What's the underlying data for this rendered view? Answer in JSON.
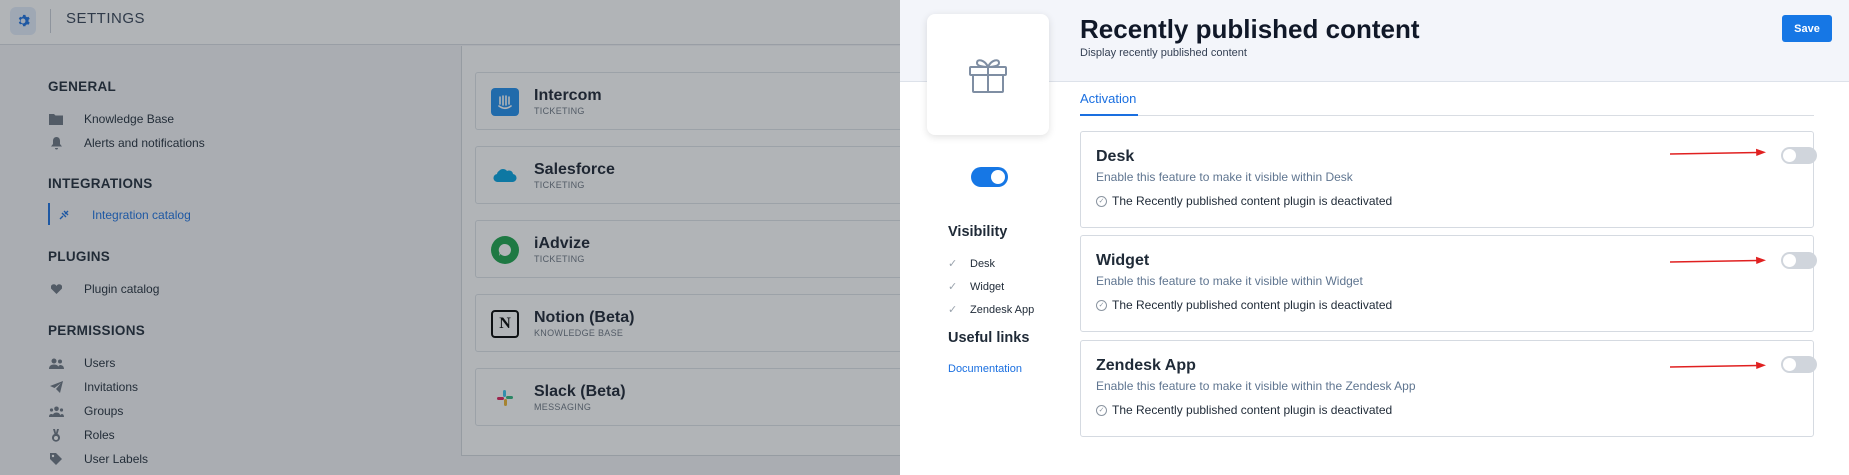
{
  "topbar": {
    "title": "SETTINGS",
    "icon": "gear-icon"
  },
  "sidebar": {
    "sections": [
      {
        "title": "GENERAL",
        "items": [
          {
            "label": "Knowledge Base",
            "icon": "folder-icon"
          },
          {
            "label": "Alerts and notifications",
            "icon": "bell-icon"
          }
        ]
      },
      {
        "title": "INTEGRATIONS",
        "items": [
          {
            "label": "Integration catalog",
            "icon": "plug-icon",
            "active": true
          }
        ]
      },
      {
        "title": "PLUGINS",
        "items": [
          {
            "label": "Plugin catalog",
            "icon": "heart-icon"
          }
        ]
      },
      {
        "title": "PERMISSIONS",
        "items": [
          {
            "label": "Users",
            "icon": "users-icon"
          },
          {
            "label": "Invitations",
            "icon": "paper-plane-icon"
          },
          {
            "label": "Groups",
            "icon": "group-icon"
          },
          {
            "label": "Roles",
            "icon": "medal-icon"
          },
          {
            "label": "User Labels",
            "icon": "tag-icon"
          }
        ]
      }
    ]
  },
  "catalog": {
    "items": [
      {
        "name": "Intercom",
        "category": "TICKETING",
        "icon": "intercom-logo",
        "color": "#1f8ded"
      },
      {
        "name": "Salesforce",
        "category": "TICKETING",
        "icon": "salesforce-logo",
        "color": "#00a1e0"
      },
      {
        "name": "iAdvize",
        "category": "TICKETING",
        "icon": "iadvize-logo",
        "color": "#19a34a"
      },
      {
        "name": "Notion (Beta)",
        "category": "KNOWLEDGE BASE",
        "icon": "notion-logo",
        "color": "#000000"
      },
      {
        "name": "Slack (Beta)",
        "category": "MESSAGING",
        "icon": "slack-logo",
        "color": "#e01e5a"
      }
    ]
  },
  "panel": {
    "title": "Recently published content",
    "subtitle": "Display recently published content",
    "save_label": "Save",
    "hero_icon": "gift-icon",
    "plugin_enabled": true,
    "tab": "Activation",
    "visibility": {
      "heading": "Visibility",
      "items": [
        "Desk",
        "Widget",
        "Zendesk App"
      ]
    },
    "links": {
      "heading": "Useful links",
      "documentation": "Documentation"
    },
    "features": [
      {
        "title": "Desk",
        "description": "Enable this feature to make it visible within Desk",
        "status": "The Recently published content plugin is deactivated",
        "enabled": false
      },
      {
        "title": "Widget",
        "description": "Enable this feature to make it visible within Widget",
        "status": "The Recently published content plugin is deactivated",
        "enabled": false
      },
      {
        "title": "Zendesk App",
        "description": "Enable this feature to make it visible within the Zendesk App",
        "status": "The Recently published content plugin is deactivated",
        "enabled": false
      }
    ]
  },
  "colors": {
    "accent": "#1677e5",
    "arrow": "#e02020",
    "toggle_off": "#d0d5dc"
  }
}
